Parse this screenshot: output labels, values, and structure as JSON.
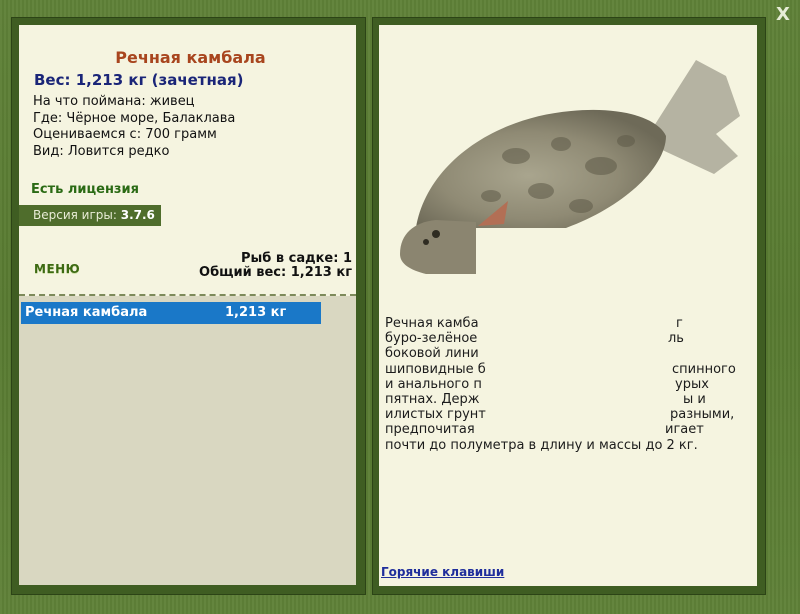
{
  "fish": {
    "title": "Речная камбала",
    "weight_line": "Вес: 1,213 кг (зачетная)",
    "bait_line": "На что поймана: живец",
    "where_line": "Где: Чёрное море, Балаклава",
    "rated_line": "Оцениваемся с: 700 грамм",
    "kind_line": "Вид: Ловится редко"
  },
  "license": "Есть лицензия",
  "version": {
    "label": "Версия игры:",
    "value": "3.7.6"
  },
  "menu": "МЕНЮ",
  "keepnet": {
    "count_line": "Рыб в садке: 1",
    "total_line": "Общий вес: 1,213 кг"
  },
  "catch_list": [
    {
      "name": "Речная камбала",
      "weight": "1,213 кг"
    }
  ],
  "description": {
    "lines": [
      "Речная камба",
      "буро-зелёное",
      "боковой лини",
      "шиповидные б",
      "и анального п",
      "пятнах. Держ",
      "илистых грунт",
      "предпочитая",
      "почти до полуметра в длину и массы до 2 кг."
    ],
    "right_fragments": [
      "г",
      "ль",
      "спинного",
      "урых",
      "ы и",
      "разными,",
      "игает"
    ]
  },
  "hotkeys": "Горячие клавиши",
  "close": "X"
}
